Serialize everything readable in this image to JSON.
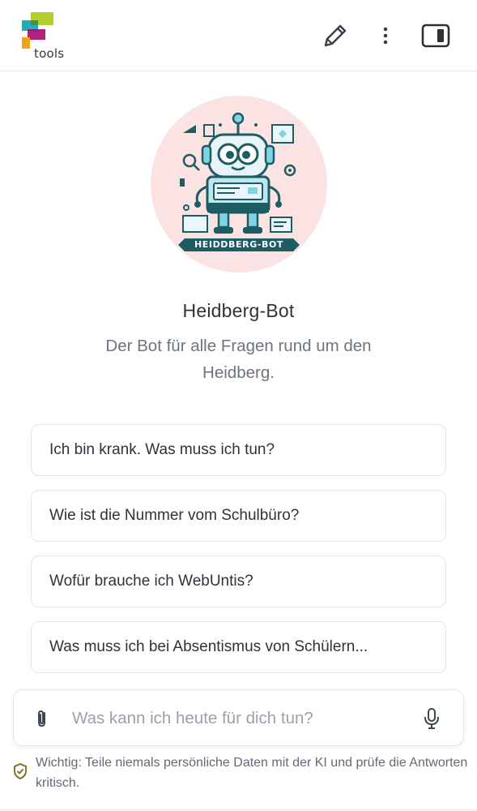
{
  "header": {
    "logo_text": "tools",
    "edit_label": "edit",
    "more_label": "more",
    "sidebar_label": "sidebar"
  },
  "bot": {
    "name": "Heidberg-Bot",
    "description": "Der Bot für alle Fragen rund um den Heidberg.",
    "avatar_banner": "HEIDDBERG-BOT"
  },
  "suggestions": [
    "Ich bin krank. Was muss ich tun?",
    "Wie ist die Nummer vom Schulbüro?",
    "Wofür brauche ich WebUntis?",
    "Was muss ich bei Absentismus von Schülern..."
  ],
  "composer": {
    "placeholder": "Was kann ich heute für dich tun?",
    "value": ""
  },
  "disclaimer": "Wichtig: Teile niemals persönliche Daten mit der KI und prüfe die Antworten kritisch.",
  "icons": {
    "edit": "pencil-icon",
    "more": "more-vertical-icon",
    "sidebar": "sidebar-toggle-icon",
    "attach": "paperclip-icon",
    "mic": "microphone-icon",
    "disclaimer": "shield-check-icon"
  },
  "colors": {
    "logo_green": "#b5cf2f",
    "logo_teal": "#1eb0b7",
    "logo_magenta": "#b3227a",
    "logo_orange": "#f3a21d",
    "avatar_bg": "#fbe3e3",
    "robot_teal": "#1d5c63",
    "robot_cyan": "#7fd3e3"
  }
}
